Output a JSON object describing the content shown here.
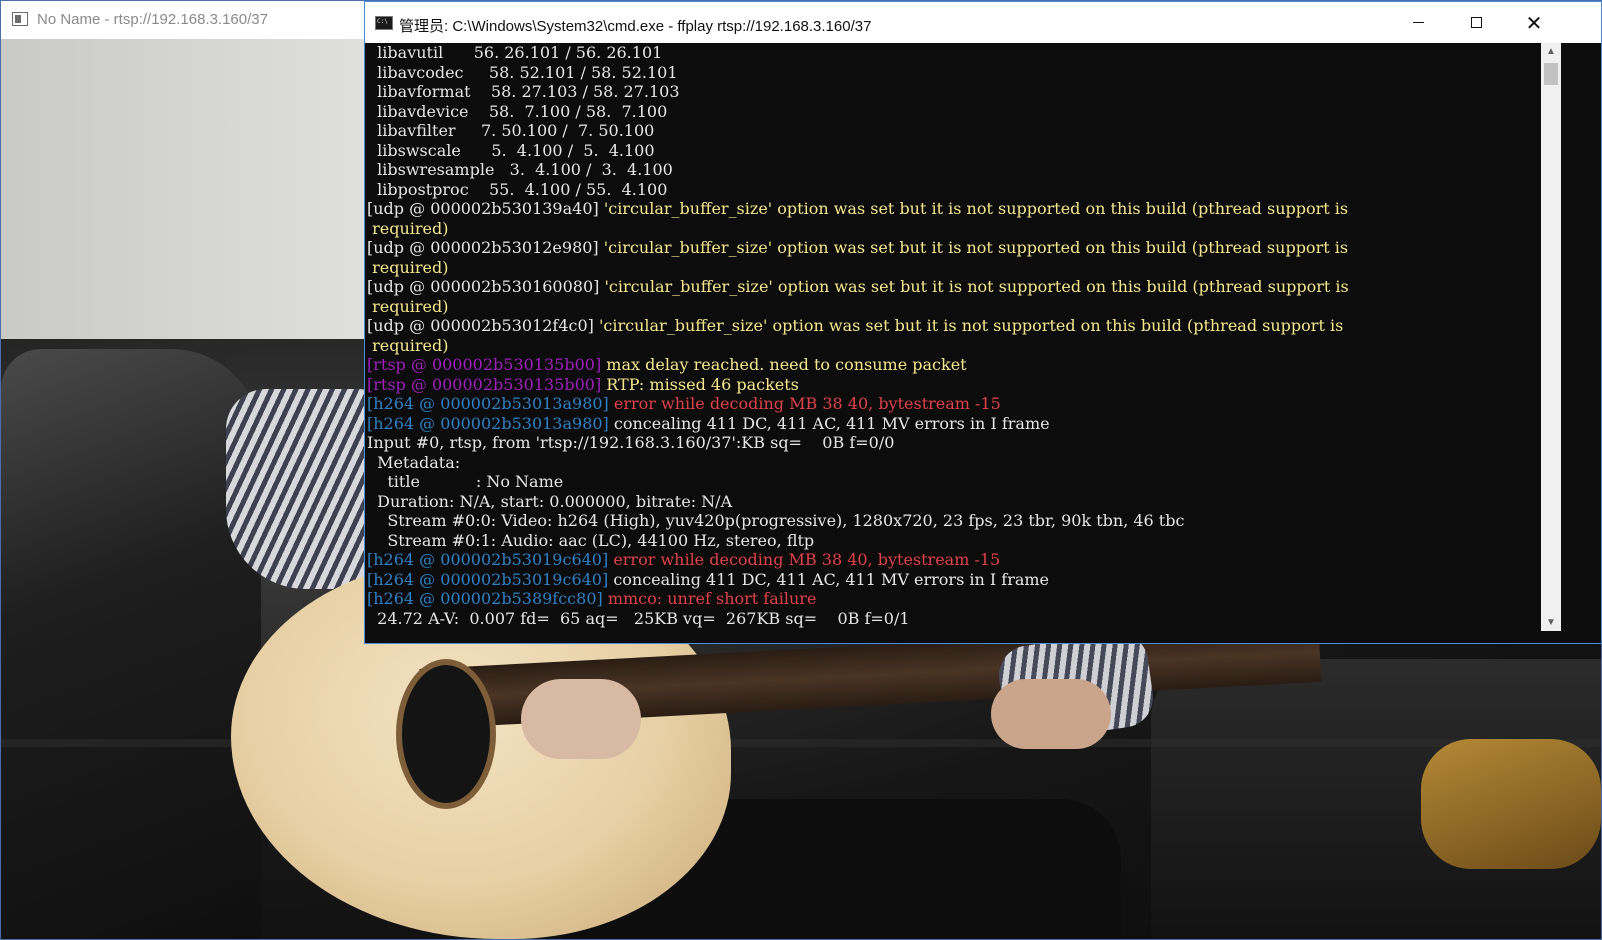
{
  "ffplay_window": {
    "title": "No Name - rtsp://192.168.3.160/37",
    "icon": "app-window-icon"
  },
  "cmd_window": {
    "title": "管理员: C:\\Windows\\System32\\cmd.exe - ffplay  rtsp://192.168.3.160/37",
    "icon": "cmd-icon",
    "buttons": {
      "minimize": "minimize-icon",
      "maximize": "maximize-icon",
      "close": "close-icon"
    },
    "lines": [
      [
        {
          "t": "  libavutil      56. 26.101 / 56. 26.101",
          "c": "default"
        }
      ],
      [
        {
          "t": "  libavcodec     58. 52.101 / 58. 52.101",
          "c": "default"
        }
      ],
      [
        {
          "t": "  libavformat    58. 27.103 / 58. 27.103",
          "c": "default"
        }
      ],
      [
        {
          "t": "  libavdevice    58.  7.100 / 58.  7.100",
          "c": "default"
        }
      ],
      [
        {
          "t": "  libavfilter     7. 50.100 /  7. 50.100",
          "c": "default"
        }
      ],
      [
        {
          "t": "  libswscale      5.  4.100 /  5.  4.100",
          "c": "default"
        }
      ],
      [
        {
          "t": "  libswresample   3.  4.100 /  3.  4.100",
          "c": "default"
        }
      ],
      [
        {
          "t": "  libpostproc    55.  4.100 / 55.  4.100",
          "c": "default"
        }
      ],
      [
        {
          "t": "[udp @ 000002b530139a40] ",
          "c": "default"
        },
        {
          "t": "'circular_buffer_size' option was set but it is not supported on this build (pthread support is",
          "c": "yellow"
        }
      ],
      [
        {
          "t": " required)",
          "c": "yellow"
        }
      ],
      [
        {
          "t": "[udp @ 000002b53012e980] ",
          "c": "default"
        },
        {
          "t": "'circular_buffer_size' option was set but it is not supported on this build (pthread support is",
          "c": "yellow"
        }
      ],
      [
        {
          "t": " required)",
          "c": "yellow"
        }
      ],
      [
        {
          "t": "[udp @ 000002b530160080] ",
          "c": "default"
        },
        {
          "t": "'circular_buffer_size' option was set but it is not supported on this build (pthread support is",
          "c": "yellow"
        }
      ],
      [
        {
          "t": " required)",
          "c": "yellow"
        }
      ],
      [
        {
          "t": "[udp @ 000002b53012f4c0] ",
          "c": "default"
        },
        {
          "t": "'circular_buffer_size' option was set but it is not supported on this build (pthread support is",
          "c": "yellow"
        }
      ],
      [
        {
          "t": " required)",
          "c": "yellow"
        }
      ],
      [
        {
          "t": "[rtsp @ 000002b530135b00] ",
          "c": "purple"
        },
        {
          "t": "max delay reached. need to consume packet",
          "c": "yellow"
        }
      ],
      [
        {
          "t": "[rtsp @ 000002b530135b00] ",
          "c": "purple"
        },
        {
          "t": "RTP: missed 46 packets",
          "c": "yellow"
        }
      ],
      [
        {
          "t": "[h264 @ 000002b53013a980] ",
          "c": "cyan"
        },
        {
          "t": "error while decoding MB 38 40, bytestream -15",
          "c": "red"
        }
      ],
      [
        {
          "t": "[h264 @ 000002b53013a980] ",
          "c": "cyan"
        },
        {
          "t": "concealing 411 DC, 411 AC, 411 MV errors in I frame",
          "c": "default"
        }
      ],
      [
        {
          "t": "Input #0, rtsp, from 'rtsp://192.168.3.160/37':KB sq=    0B f=0/0",
          "c": "default"
        }
      ],
      [
        {
          "t": "  Metadata:",
          "c": "default"
        }
      ],
      [
        {
          "t": "    title           : No Name",
          "c": "default"
        }
      ],
      [
        {
          "t": "  Duration: N/A, start: 0.000000, bitrate: N/A",
          "c": "default"
        }
      ],
      [
        {
          "t": "    Stream #0:0: Video: h264 (High), yuv420p(progressive), 1280x720, 23 fps, 23 tbr, 90k tbn, 46 tbc",
          "c": "default"
        }
      ],
      [
        {
          "t": "    Stream #0:1: Audio: aac (LC), 44100 Hz, stereo, fltp",
          "c": "default"
        }
      ],
      [
        {
          "t": "[h264 @ 000002b53019c640] ",
          "c": "cyan"
        },
        {
          "t": "error while decoding MB 38 40, bytestream -15",
          "c": "red"
        }
      ],
      [
        {
          "t": "[h264 @ 000002b53019c640] ",
          "c": "cyan"
        },
        {
          "t": "concealing 411 DC, 411 AC, 411 MV errors in I frame",
          "c": "default"
        }
      ],
      [
        {
          "t": "[h264 @ 000002b5389fcc80] ",
          "c": "cyan"
        },
        {
          "t": "mmco: unref short failure",
          "c": "red"
        }
      ],
      [
        {
          "t": "  24.72 A-V:  0.007 fd=  65 aq=   25KB vq=  267KB sq=    0B f=0/1",
          "c": "default"
        }
      ]
    ]
  },
  "scrollbar": {
    "up": "▲",
    "down": "▼"
  }
}
